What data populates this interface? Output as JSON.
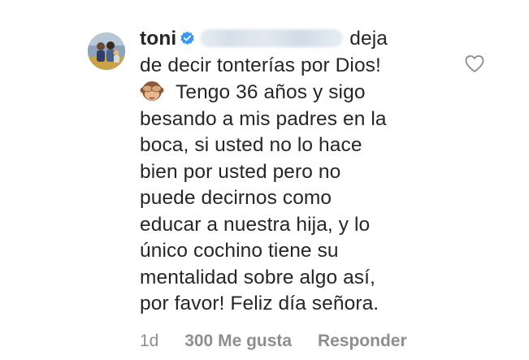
{
  "comment": {
    "username": "toni",
    "line1_suffix": "deja",
    "line2": "de decir tonterías por Dios!",
    "emoji_name": "see-no-evil-monkey",
    "lines_after_emoji": "Tengo 36 años y sigo",
    "line4": "besando a mis padres en la",
    "line5": "boca, si usted no lo hace",
    "line6": "bien por usted pero no",
    "line7": "puede decirnos como",
    "line8": "educar a nuestra hija, y lo",
    "line9": "único cochino tiene su",
    "line10": "mentalidad sobre algo así,",
    "line11": "por favor! Feliz día señora.",
    "time": "1d",
    "likes": "300 Me gusta",
    "reply": "Responder"
  },
  "icons": {
    "verified": "verified-badge-icon",
    "heart": "heart-outline-icon"
  },
  "colors": {
    "text": "#262626",
    "meta": "#8e8e8e",
    "verified": "#3897f0"
  }
}
